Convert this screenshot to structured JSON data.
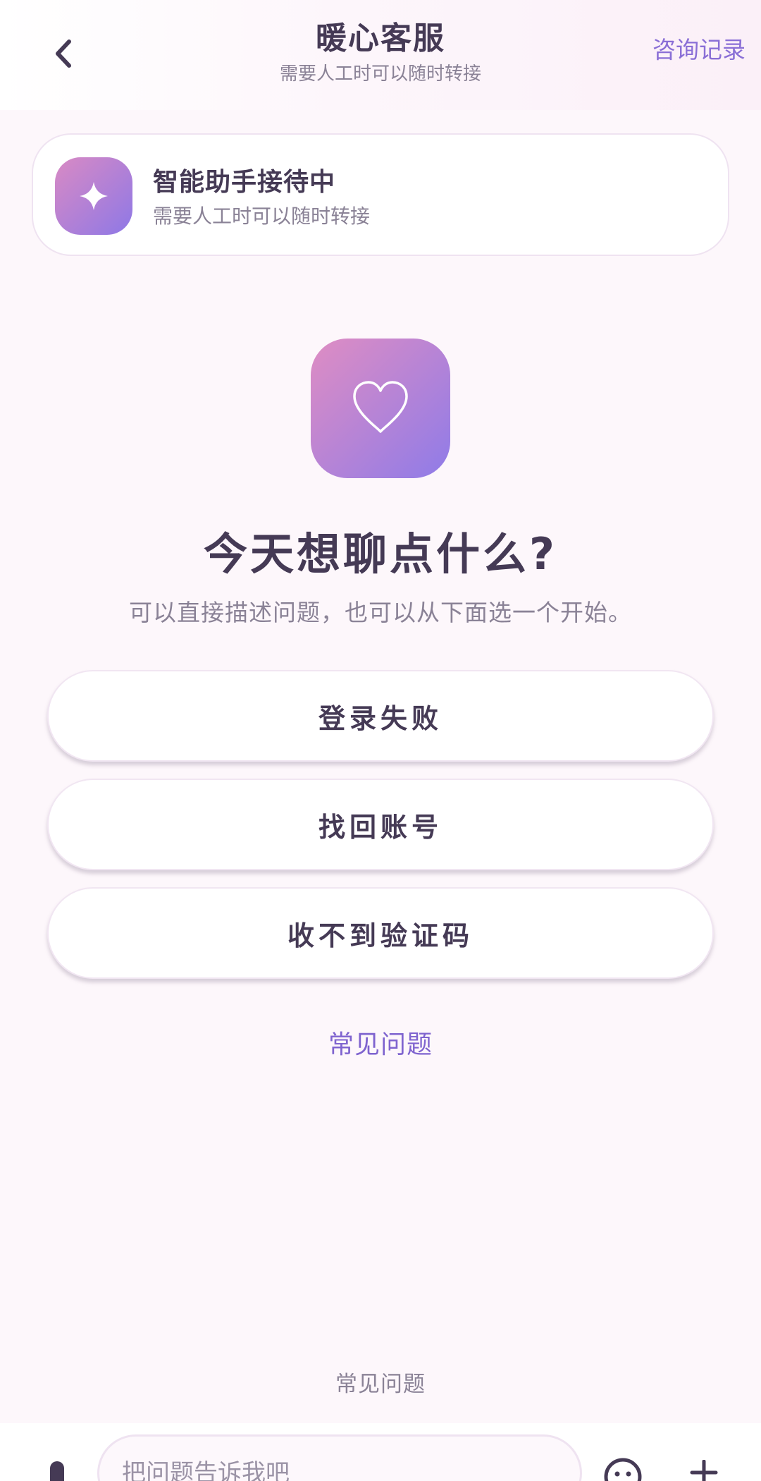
{
  "header": {
    "title": "暖心客服",
    "subtitle": "需要人工时可以随时转接",
    "history_label": "咨询记录"
  },
  "status_card": {
    "title": "智能助手接待中",
    "subtitle": "需要人工时可以随时转接"
  },
  "hero": {
    "title": "今天想聊点什么?",
    "subtitle": "可以直接描述问题，也可以从下面选一个开始。"
  },
  "quick_actions": [
    {
      "label": "登录失败"
    },
    {
      "label": "找回账号"
    },
    {
      "label": "收不到验证码"
    }
  ],
  "faq_link_label": "常见问题",
  "faq_footer_label": "常见问题",
  "input": {
    "placeholder": "把问题告诉我吧",
    "value": ""
  },
  "icons": {
    "back": "chevron-left-icon",
    "status": "sparkle-icon",
    "hero": "heart-icon",
    "mic": "microphone-icon",
    "emoji": "smiley-icon",
    "plus": "plus-icon"
  },
  "colors": {
    "accent": "#8a6fd6",
    "gradient_start": "#df8dc3",
    "gradient_end": "#8f7be8",
    "text_primary": "#453a55",
    "text_secondary": "#8a8296",
    "background": "#fdf7fb"
  }
}
